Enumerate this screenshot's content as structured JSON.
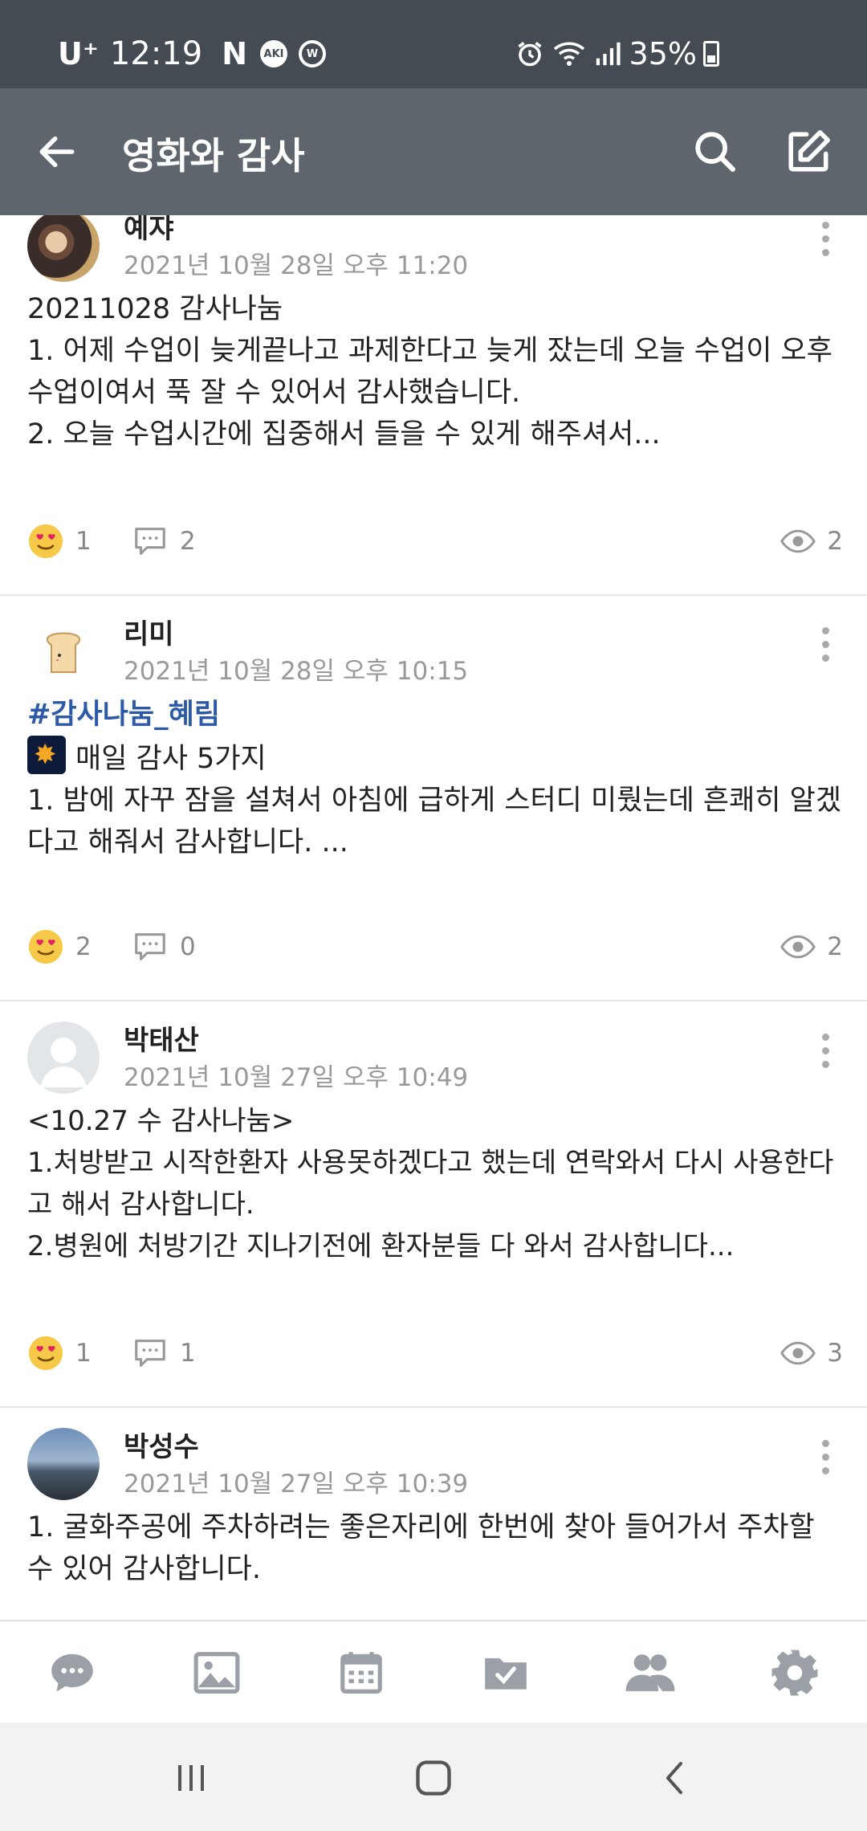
{
  "status_bar": {
    "carrier": "U⁺",
    "time": "12:19",
    "app_icons": [
      "N",
      "AKI",
      "W"
    ],
    "battery": "35%"
  },
  "app_bar": {
    "title": "영화와 감사",
    "icons": [
      "back-arrow-icon",
      "search-icon",
      "write-icon"
    ]
  },
  "posts": [
    {
      "author": "예쟈",
      "date": "2021년 10월 28일 오후 11:20",
      "body": "20211028 감사나눔\n1. 어제 수업이 늦게끝나고 과제한다고 늦게 잤는데 오늘 수업이 오후 수업이여서 푹 잘 수 있어서 감사했습니다.\n2. 오늘 수업시간에 집중해서 들을 수 있게 해주셔서...",
      "reactions": "1",
      "comments": "2",
      "views": "2"
    },
    {
      "author": "리미",
      "date": "2021년 10월 28일 오후 10:15",
      "hashtag": "#감사나눔_혜림",
      "headline": "매일 감사 5가지",
      "body": "1. 밤에 자꾸 잠을 설쳐서 아침에 급하게 스터디 미뤘는데 흔쾌히 알겠다고 해줘서 감사합니다. ...",
      "reactions": "2",
      "comments": "0",
      "views": "2"
    },
    {
      "author": "박태산",
      "date": "2021년 10월 27일 오후 10:49",
      "body": "<10.27 수 감사나눔>\n1.처방받고 시작한환자 사용못하겠다고 했는데 연락와서 다시 사용한다고 해서 감사합니다.\n2.병원에 처방기간 지나기전에 환자분들 다 와서 감사합니다...",
      "reactions": "1",
      "comments": "1",
      "views": "3"
    },
    {
      "author": "박성수",
      "date": "2021년 10월 27일 오후 10:39",
      "body": "1. 굴화주공에 주차하려는 좋은자리에 한번에 찾아 들어가서 주차할 수 있어 감사합니다."
    }
  ],
  "tab_bar": [
    "chat-icon",
    "photo-icon",
    "calendar-icon",
    "folder-check-icon",
    "members-icon",
    "settings-icon"
  ],
  "nav_bar": [
    "recents-icon",
    "home-icon",
    "back-icon"
  ],
  "colors": {
    "status_bar": "#454b52",
    "app_bar": "#5e656c",
    "hashtag": "#2d5aa6",
    "icon_gray": "#9aa0a6"
  }
}
